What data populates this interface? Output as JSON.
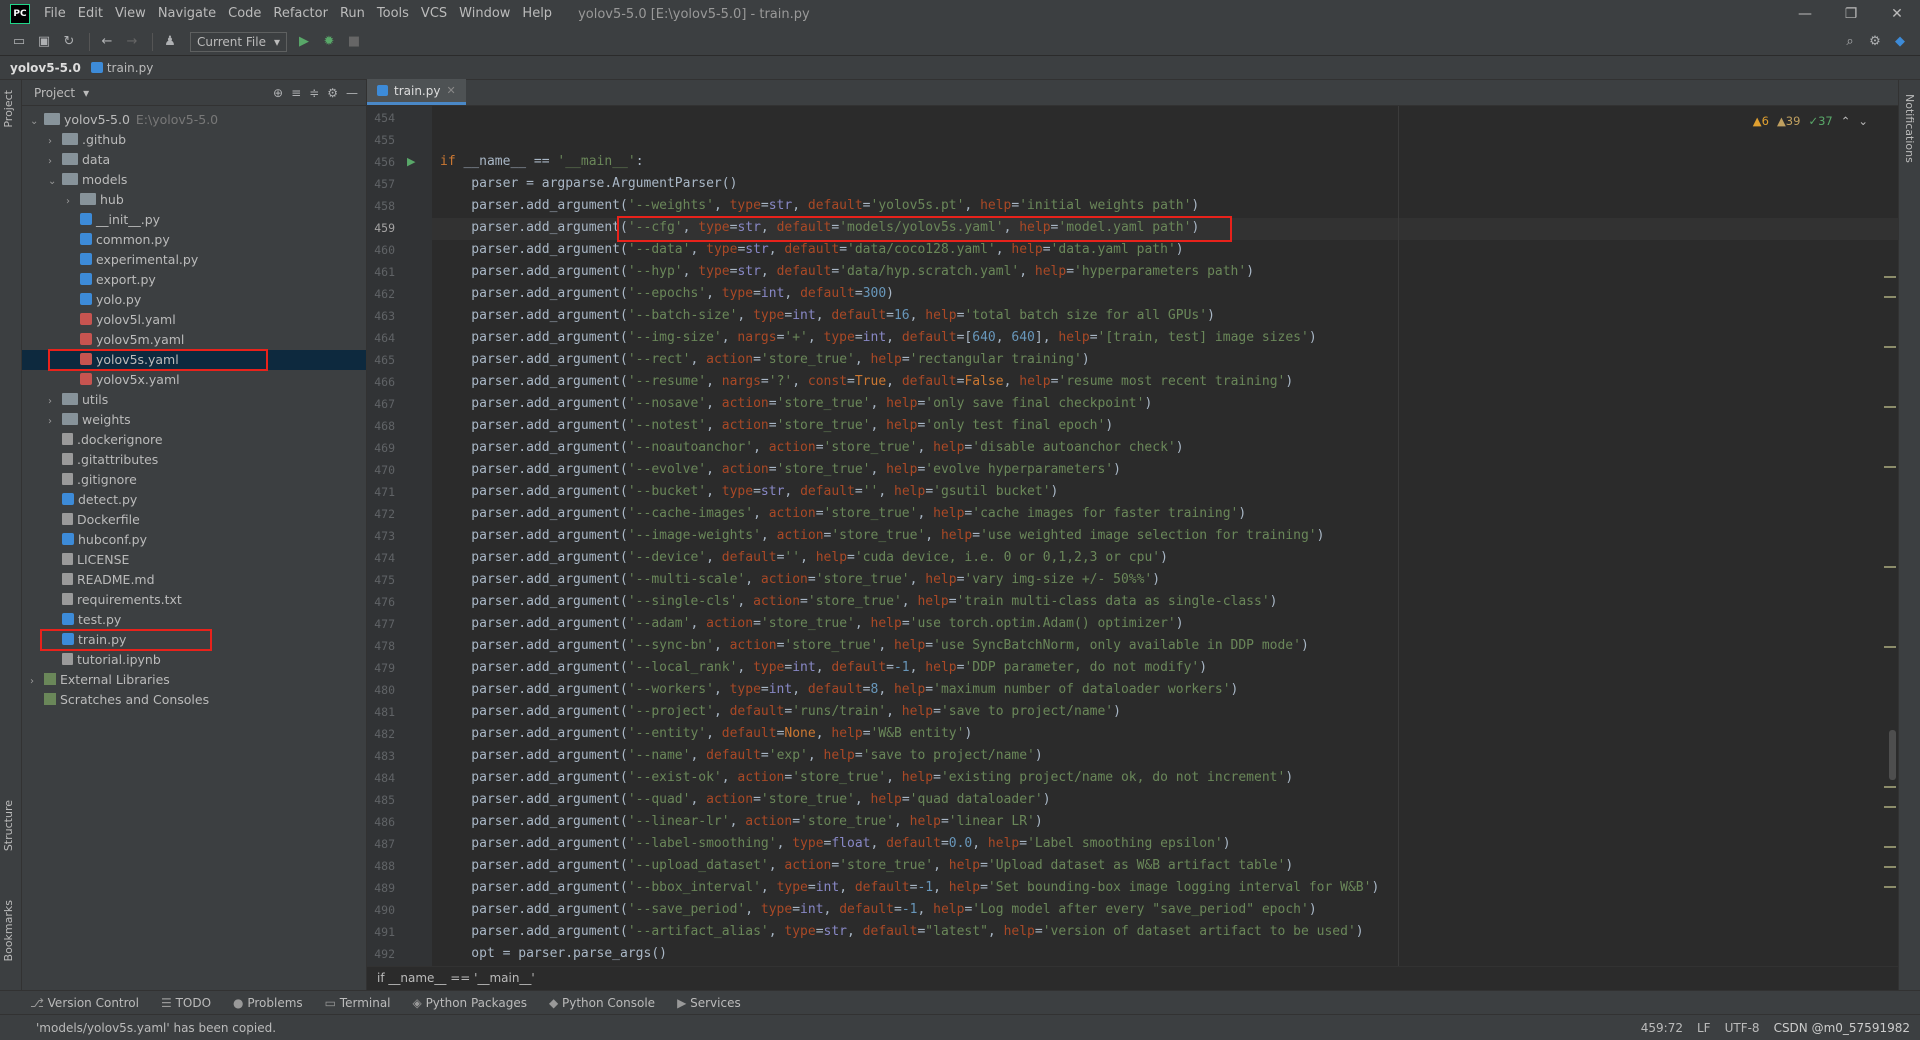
{
  "app": {
    "logo": "PC",
    "title": "yolov5-5.0 [E:\\yolov5-5.0] - train.py"
  },
  "menu": [
    "File",
    "Edit",
    "View",
    "Navigate",
    "Code",
    "Refactor",
    "Run",
    "Tools",
    "VCS",
    "Window",
    "Help"
  ],
  "window_controls": [
    "—",
    "❐",
    "✕"
  ],
  "toolbar": {
    "run_config": "Current File"
  },
  "nav": {
    "project": "yolov5-5.0",
    "file": "train.py"
  },
  "project_panel": {
    "title": "Project",
    "tree": [
      {
        "label": "yolov5-5.0",
        "hint": "E:\\yolov5-5.0",
        "level": 0,
        "type": "folder",
        "arrow": "v"
      },
      {
        "label": ".github",
        "level": 1,
        "type": "folder",
        "arrow": ">"
      },
      {
        "label": "data",
        "level": 1,
        "type": "folder",
        "arrow": ">"
      },
      {
        "label": "models",
        "level": 1,
        "type": "folder",
        "arrow": "v"
      },
      {
        "label": "hub",
        "level": 2,
        "type": "folder",
        "arrow": ">"
      },
      {
        "label": "__init__.py",
        "level": 2,
        "type": "py"
      },
      {
        "label": "common.py",
        "level": 2,
        "type": "py"
      },
      {
        "label": "experimental.py",
        "level": 2,
        "type": "py"
      },
      {
        "label": "export.py",
        "level": 2,
        "type": "py"
      },
      {
        "label": "yolo.py",
        "level": 2,
        "type": "py"
      },
      {
        "label": "yolov5l.yaml",
        "level": 2,
        "type": "yaml"
      },
      {
        "label": "yolov5m.yaml",
        "level": 2,
        "type": "yaml"
      },
      {
        "label": "yolov5s.yaml",
        "level": 2,
        "type": "yaml",
        "selected": true
      },
      {
        "label": "yolov5x.yaml",
        "level": 2,
        "type": "yaml"
      },
      {
        "label": "utils",
        "level": 1,
        "type": "folder",
        "arrow": ">"
      },
      {
        "label": "weights",
        "level": 1,
        "type": "folder",
        "arrow": ">"
      },
      {
        "label": ".dockerignore",
        "level": 1,
        "type": "file"
      },
      {
        "label": ".gitattributes",
        "level": 1,
        "type": "file"
      },
      {
        "label": ".gitignore",
        "level": 1,
        "type": "file"
      },
      {
        "label": "detect.py",
        "level": 1,
        "type": "py"
      },
      {
        "label": "Dockerfile",
        "level": 1,
        "type": "file"
      },
      {
        "label": "hubconf.py",
        "level": 1,
        "type": "py"
      },
      {
        "label": "LICENSE",
        "level": 1,
        "type": "file"
      },
      {
        "label": "README.md",
        "level": 1,
        "type": "file"
      },
      {
        "label": "requirements.txt",
        "level": 1,
        "type": "file"
      },
      {
        "label": "test.py",
        "level": 1,
        "type": "py"
      },
      {
        "label": "train.py",
        "level": 1,
        "type": "py"
      },
      {
        "label": "tutorial.ipynb",
        "level": 1,
        "type": "file"
      },
      {
        "label": "External Libraries",
        "level": 0,
        "type": "lib",
        "arrow": ">"
      },
      {
        "label": "Scratches and Consoles",
        "level": 0,
        "type": "lib"
      }
    ]
  },
  "side_tabs": {
    "project": "Project",
    "structure": "Structure",
    "bookmarks": "Bookmarks",
    "notifications": "Notifications"
  },
  "editor": {
    "tab": "train.py",
    "inspections": {
      "warn1": "▲6",
      "warn2": "▲39",
      "ok": "✓37"
    },
    "current_line": 459,
    "lines": [
      {
        "n": 454,
        "code": ""
      },
      {
        "n": 455,
        "code": ""
      },
      {
        "n": 456,
        "code": "if __name__ == '__main__':"
      },
      {
        "n": 457,
        "code": "    parser = argparse.ArgumentParser()"
      },
      {
        "n": 458,
        "code": "    parser.add_argument('--weights', type=str, default='yolov5s.pt', help='initial weights path')"
      },
      {
        "n": 459,
        "code": "    parser.add_argument('--cfg', type=str, default='models/yolov5s.yaml', help='model.yaml path')"
      },
      {
        "n": 460,
        "code": "    parser.add_argument('--data', type=str, default='data/coco128.yaml', help='data.yaml path')"
      },
      {
        "n": 461,
        "code": "    parser.add_argument('--hyp', type=str, default='data/hyp.scratch.yaml', help='hyperparameters path')"
      },
      {
        "n": 462,
        "code": "    parser.add_argument('--epochs', type=int, default=300)"
      },
      {
        "n": 463,
        "code": "    parser.add_argument('--batch-size', type=int, default=16, help='total batch size for all GPUs')"
      },
      {
        "n": 464,
        "code": "    parser.add_argument('--img-size', nargs='+', type=int, default=[640, 640], help='[train, test] image sizes')"
      },
      {
        "n": 465,
        "code": "    parser.add_argument('--rect', action='store_true', help='rectangular training')"
      },
      {
        "n": 466,
        "code": "    parser.add_argument('--resume', nargs='?', const=True, default=False, help='resume most recent training')"
      },
      {
        "n": 467,
        "code": "    parser.add_argument('--nosave', action='store_true', help='only save final checkpoint')"
      },
      {
        "n": 468,
        "code": "    parser.add_argument('--notest', action='store_true', help='only test final epoch')"
      },
      {
        "n": 469,
        "code": "    parser.add_argument('--noautoanchor', action='store_true', help='disable autoanchor check')"
      },
      {
        "n": 470,
        "code": "    parser.add_argument('--evolve', action='store_true', help='evolve hyperparameters')"
      },
      {
        "n": 471,
        "code": "    parser.add_argument('--bucket', type=str, default='', help='gsutil bucket')"
      },
      {
        "n": 472,
        "code": "    parser.add_argument('--cache-images', action='store_true', help='cache images for faster training')"
      },
      {
        "n": 473,
        "code": "    parser.add_argument('--image-weights', action='store_true', help='use weighted image selection for training')"
      },
      {
        "n": 474,
        "code": "    parser.add_argument('--device', default='', help='cuda device, i.e. 0 or 0,1,2,3 or cpu')"
      },
      {
        "n": 475,
        "code": "    parser.add_argument('--multi-scale', action='store_true', help='vary img-size +/- 50%%')"
      },
      {
        "n": 476,
        "code": "    parser.add_argument('--single-cls', action='store_true', help='train multi-class data as single-class')"
      },
      {
        "n": 477,
        "code": "    parser.add_argument('--adam', action='store_true', help='use torch.optim.Adam() optimizer')"
      },
      {
        "n": 478,
        "code": "    parser.add_argument('--sync-bn', action='store_true', help='use SyncBatchNorm, only available in DDP mode')"
      },
      {
        "n": 479,
        "code": "    parser.add_argument('--local_rank', type=int, default=-1, help='DDP parameter, do not modify')"
      },
      {
        "n": 480,
        "code": "    parser.add_argument('--workers', type=int, default=8, help='maximum number of dataloader workers')"
      },
      {
        "n": 481,
        "code": "    parser.add_argument('--project', default='runs/train', help='save to project/name')"
      },
      {
        "n": 482,
        "code": "    parser.add_argument('--entity', default=None, help='W&B entity')"
      },
      {
        "n": 483,
        "code": "    parser.add_argument('--name', default='exp', help='save to project/name')"
      },
      {
        "n": 484,
        "code": "    parser.add_argument('--exist-ok', action='store_true', help='existing project/name ok, do not increment')"
      },
      {
        "n": 485,
        "code": "    parser.add_argument('--quad', action='store_true', help='quad dataloader')"
      },
      {
        "n": 486,
        "code": "    parser.add_argument('--linear-lr', action='store_true', help='linear LR')"
      },
      {
        "n": 487,
        "code": "    parser.add_argument('--label-smoothing', type=float, default=0.0, help='Label smoothing epsilon')"
      },
      {
        "n": 488,
        "code": "    parser.add_argument('--upload_dataset', action='store_true', help='Upload dataset as W&B artifact table')"
      },
      {
        "n": 489,
        "code": "    parser.add_argument('--bbox_interval', type=int, default=-1, help='Set bounding-box image logging interval for W&B')"
      },
      {
        "n": 490,
        "code": "    parser.add_argument('--save_period', type=int, default=-1, help='Log model after every \"save_period\" epoch')"
      },
      {
        "n": 491,
        "code": "    parser.add_argument('--artifact_alias', type=str, default=\"latest\", help='version of dataset artifact to be used')"
      },
      {
        "n": 492,
        "code": "    opt = parser.parse_args()"
      }
    ],
    "breadcrumb": "if __name__ == '__main__'"
  },
  "bottom_tabs": [
    "Version Control",
    "TODO",
    "Problems",
    "Terminal",
    "Python Packages",
    "Python Console",
    "Services"
  ],
  "status": {
    "message": "'models/yolov5s.yaml' has been copied.",
    "position": "459:72",
    "line_sep": "LF",
    "encoding": "UTF-8",
    "watermark": "CSDN @m0_57591982"
  }
}
